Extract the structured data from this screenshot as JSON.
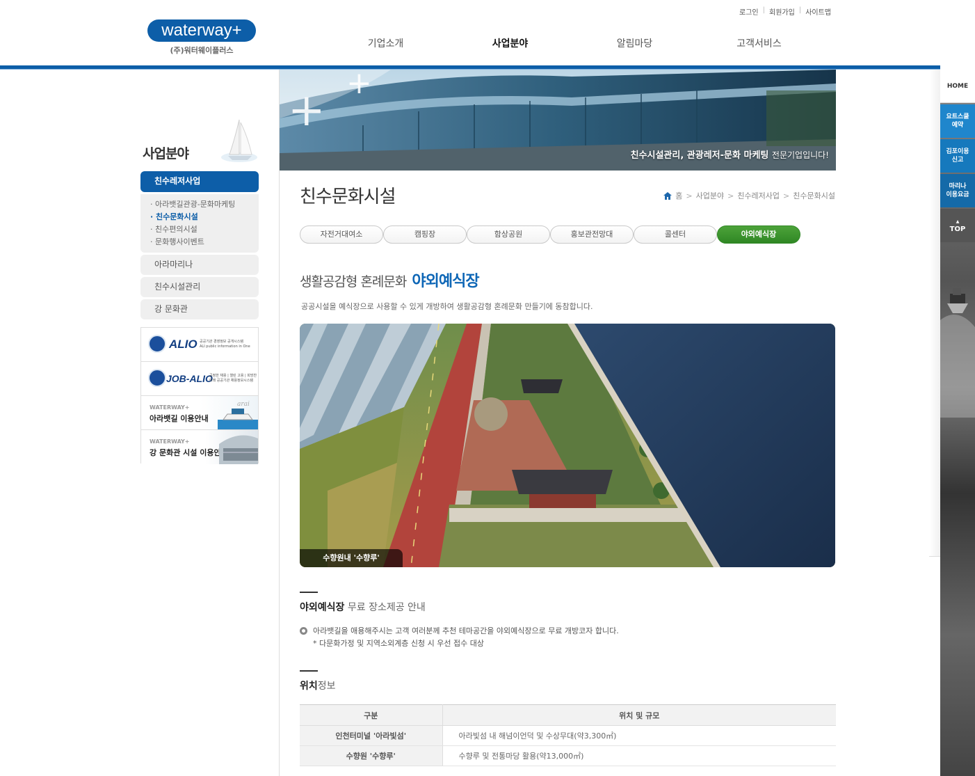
{
  "header": {
    "logo_text": "waterway+",
    "logo_sub": "(주)워터웨이플러스",
    "util": [
      "로그인",
      "회원가입",
      "사이트맵"
    ],
    "gnb": [
      "기업소개",
      "사업분야",
      "알림마당",
      "고객서비스"
    ],
    "gnb_active_index": 1
  },
  "quick": {
    "home": "HOME",
    "yacht": "요트스쿨\n예약",
    "gimpo": "김포이용\n신고",
    "marina": "마리나\n이용요금",
    "top": "TOP"
  },
  "sidebar": {
    "title": "사업분야",
    "main_item": "친수레저사업",
    "sub_items": [
      "아라뱃길관광-문화마케팅",
      "친수문화시설",
      "친수편의시설",
      "문화행사이벤트"
    ],
    "sub_active_index": 1,
    "items": [
      "아라마리나",
      "친수시설관리",
      "강 문화관"
    ],
    "banners": {
      "alio_title": "ALIO",
      "alio_desc": "공공기관 경영정보 공개시스템\nALI public information in One",
      "jobalio_title": "JOB-ALIO",
      "jobalio_desc": "공정한 채용 | 열린 고용 | 희망찬 미래\n공공기관 채용정보시스템",
      "ara_small": "WATERWAY+",
      "ara_label": "아라뱃길 이용안내",
      "ara_script": "arai",
      "gang_small": "WATERWAY+",
      "gang_label": "강 문화관 시설 이용안내"
    }
  },
  "visual": {
    "text_strong": "친수시설관리, 관광레저-문화 마케팅",
    "text_normal": "전문기업입니다!"
  },
  "page": {
    "title": "친수문화시설",
    "breadcrumb": [
      "홈",
      "사업분야",
      "친수레저사업",
      "친수문화시설"
    ]
  },
  "tabs": [
    "자전거대여소",
    "캠핑장",
    "함상공원",
    "홍보관전망대",
    "콜센터",
    "야외예식장"
  ],
  "tabs_active_index": 5,
  "content": {
    "head_light": "생활공감형 혼례문화",
    "head_strong": "야외예식장",
    "intro": "공공시설을 예식장으로 사용할 수 있게 개방하여 생활공감형 혼례문화 만들기에 동참합니다.",
    "photo_caption": "수향원내 '수향루'",
    "free_head_strong": "야외예식장",
    "free_head_light": "무료 장소제공 안내",
    "free_desc": "아라뱃길을 애용해주시는 고객 여러분께 추천 테마공간을 야외예식장으로 무료 개방코자 합니다.",
    "free_note": "* 다문화가정 및 지역소외계층 신청 시 우선 접수 대상",
    "loc_head_strong": "위치",
    "loc_head_light": "정보",
    "table": {
      "headers": [
        "구분",
        "위치 및 규모"
      ],
      "rows": [
        [
          "인천터미널 '아라빛섬'",
          "아라빛섬 내 해넘이언덕 및 수상무대(약3,300㎡)"
        ],
        [
          "수향원 '수향루'",
          "수향루 및 전통마당 활용(약13,000㎡)"
        ]
      ]
    }
  },
  "colors": {
    "brand_blue": "#0d5ea8",
    "accent_green": "#2f8724",
    "heading_blue": "#0d66b6"
  }
}
